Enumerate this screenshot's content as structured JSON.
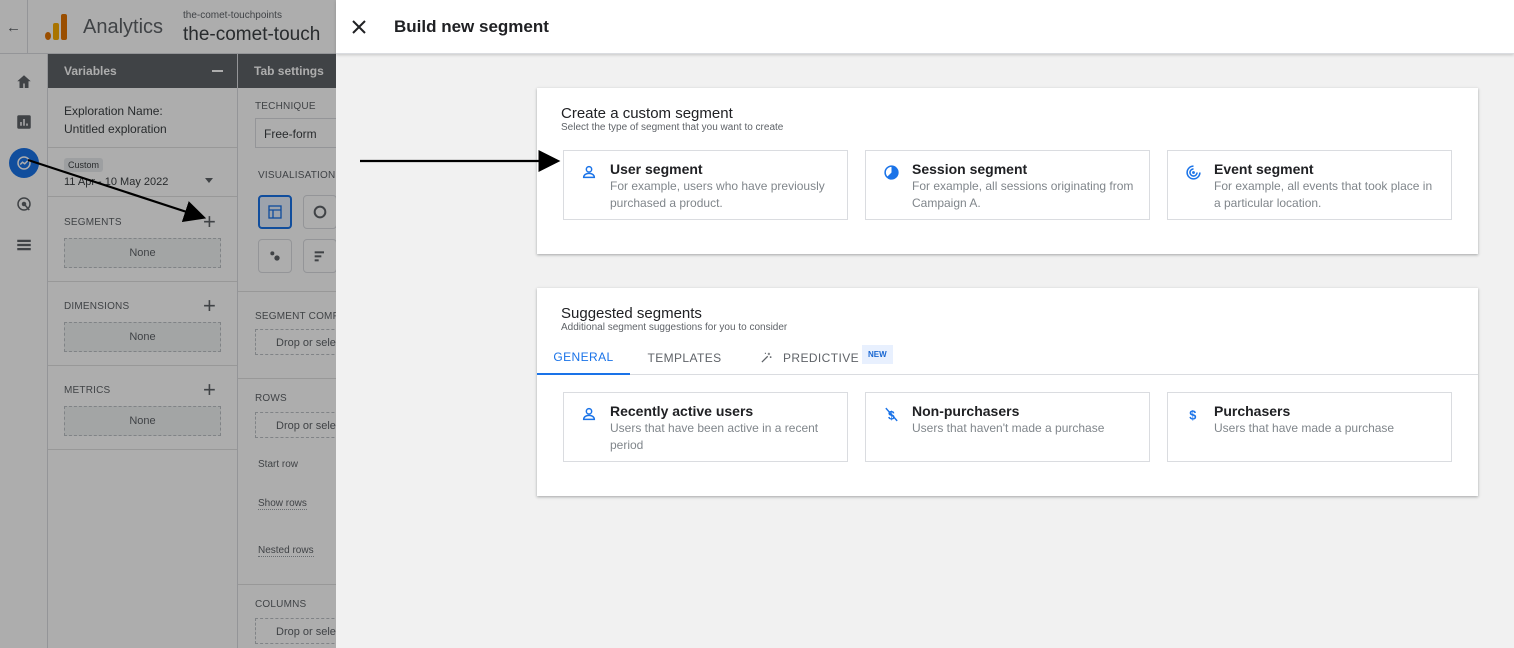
{
  "app": {
    "brand": "Analytics",
    "property_sub": "the-comet-touchpoints",
    "property_name": "the-comet-touch",
    "colors": {
      "brand_orange": "#f9ab00",
      "brand_orange_dark": "#e37400",
      "accent_blue": "#1a73e8",
      "scrim": "rgba(0,0,0,0.32)"
    }
  },
  "nav": {
    "icons": [
      "home-icon",
      "reports-icon",
      "explore-icon",
      "advertising-icon",
      "configure-icon"
    ],
    "active": "explore-icon"
  },
  "variables": {
    "header": "Variables",
    "exploration_label": "Exploration Name:",
    "exploration_name": "Untitled exploration",
    "date_chip": "Custom",
    "date_range": "11 Apr - 10 May 2022",
    "segments_label": "SEGMENTS",
    "segments_value": "None",
    "dimensions_label": "DIMENSIONS",
    "dimensions_value": "None",
    "metrics_label": "METRICS",
    "metrics_value": "None"
  },
  "tab_settings": {
    "header": "Tab settings",
    "technique_label": "TECHNIQUE",
    "technique_value": "Free-form",
    "visualisation_label": "VISUALISATION",
    "segment_comparisons_label": "SEGMENT COMPA",
    "segment_drop": "Drop or sele",
    "rows_label": "ROWS",
    "rows_drop": "Drop or selec",
    "start_row": "Start row",
    "show_rows": "Show rows",
    "nested_rows": "Nested rows",
    "columns_label": "COLUMNS",
    "columns_drop": "Drop or selec"
  },
  "dialog": {
    "title": "Build new segment",
    "custom": {
      "title": "Create a custom segment",
      "subtitle": "Select the type of segment that you want to create",
      "options": [
        {
          "title": "User segment",
          "desc": "For example, users who have previously purchased a product.",
          "icon": "person-icon"
        },
        {
          "title": "Session segment",
          "desc": "For example, all sessions originating from Campaign A.",
          "icon": "session-icon"
        },
        {
          "title": "Event segment",
          "desc": "For example, all events that took place in a particular location.",
          "icon": "event-icon"
        }
      ]
    },
    "suggested": {
      "title": "Suggested segments",
      "subtitle": "Additional segment suggestions for you to consider",
      "tabs": [
        "GENERAL",
        "TEMPLATES",
        "PREDICTIVE"
      ],
      "active_tab": "GENERAL",
      "badge": "NEW",
      "items": [
        {
          "title": "Recently active users",
          "desc": "Users that have been active in a recent period",
          "icon": "person-icon"
        },
        {
          "title": "Non-purchasers",
          "desc": "Users that haven't made a purchase",
          "icon": "no-dollar-icon"
        },
        {
          "title": "Purchasers",
          "desc": "Users that have made a purchase",
          "icon": "dollar-icon"
        }
      ]
    }
  }
}
